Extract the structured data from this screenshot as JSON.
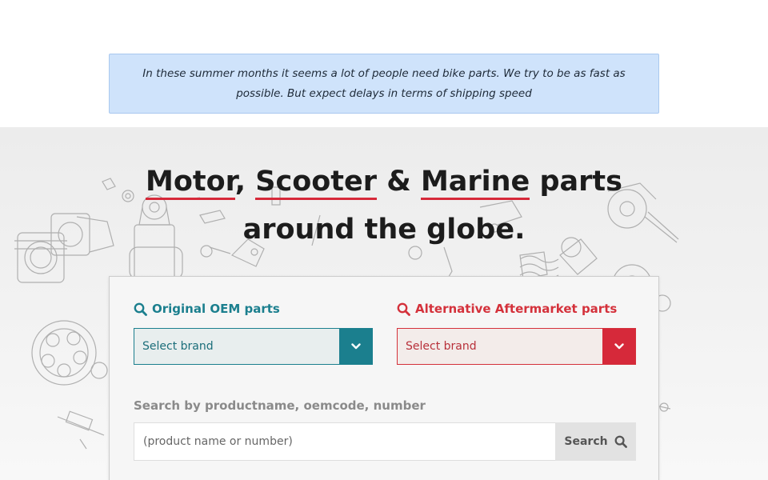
{
  "notice": {
    "text": "In these summer months it seems a lot of people need bike parts. We try to be as fast as possible. But expect delays in terms of shipping speed"
  },
  "hero": {
    "word_motor": "Motor",
    "comma": ",",
    "word_scooter": "Scooter",
    "ampersand": "&",
    "word_marine": "Marine",
    "word_parts": "parts",
    "line2": "around the globe."
  },
  "oem": {
    "label": "Original OEM parts",
    "select_value": "Select brand",
    "icon": "search-icon",
    "color": "#1b7f8e"
  },
  "aftermarket": {
    "label": "Alternative Aftermarket parts",
    "select_value": "Select brand",
    "icon": "search-icon",
    "color": "#d4313b"
  },
  "search": {
    "label": "Search by productname, oemcode, number",
    "placeholder": "(product name or number)",
    "button_label": "Search",
    "button_icon": "search-icon"
  },
  "colors": {
    "accent_red": "#d6293a",
    "accent_teal": "#1b7f8e",
    "notice_bg": "#cfe3fb"
  }
}
